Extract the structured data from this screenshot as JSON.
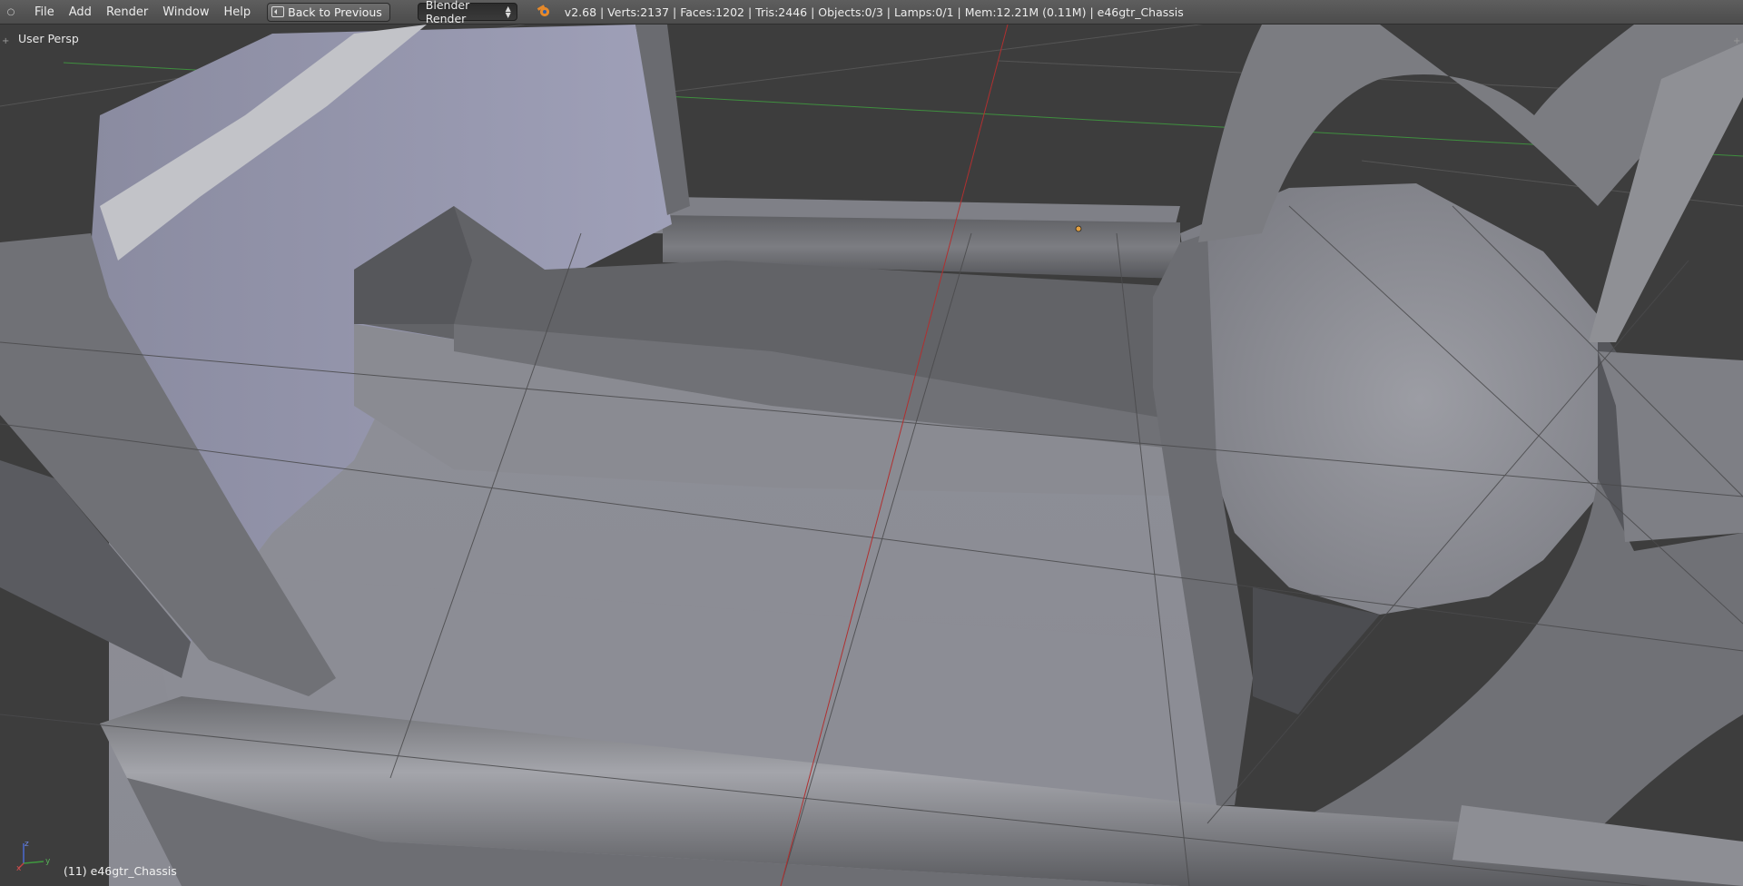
{
  "header": {
    "editor_icon": "info-editor-icon",
    "menu": [
      "File",
      "Add",
      "Render",
      "Window",
      "Help"
    ],
    "back_button": "Back to Previous",
    "render_engine": "Blender Render",
    "stats": "v2.68 | Verts:2137 | Faces:1202 | Tris:2446 | Objects:0/3 | Lamps:0/1 | Mem:12.21M (0.11M) | e46gtr_Chassis"
  },
  "viewport": {
    "view_name": "User Persp",
    "active_object": "(11) e46gtr_Chassis",
    "axis_gizmo": {
      "x": "x",
      "y": "y",
      "z": "z"
    }
  },
  "colors": {
    "background": "#3d3d3d",
    "x_axis": "#b03030",
    "y_axis": "#3f8f3f",
    "mesh_light": "#9a9ba3",
    "mesh_dark": "#5d5e62"
  }
}
